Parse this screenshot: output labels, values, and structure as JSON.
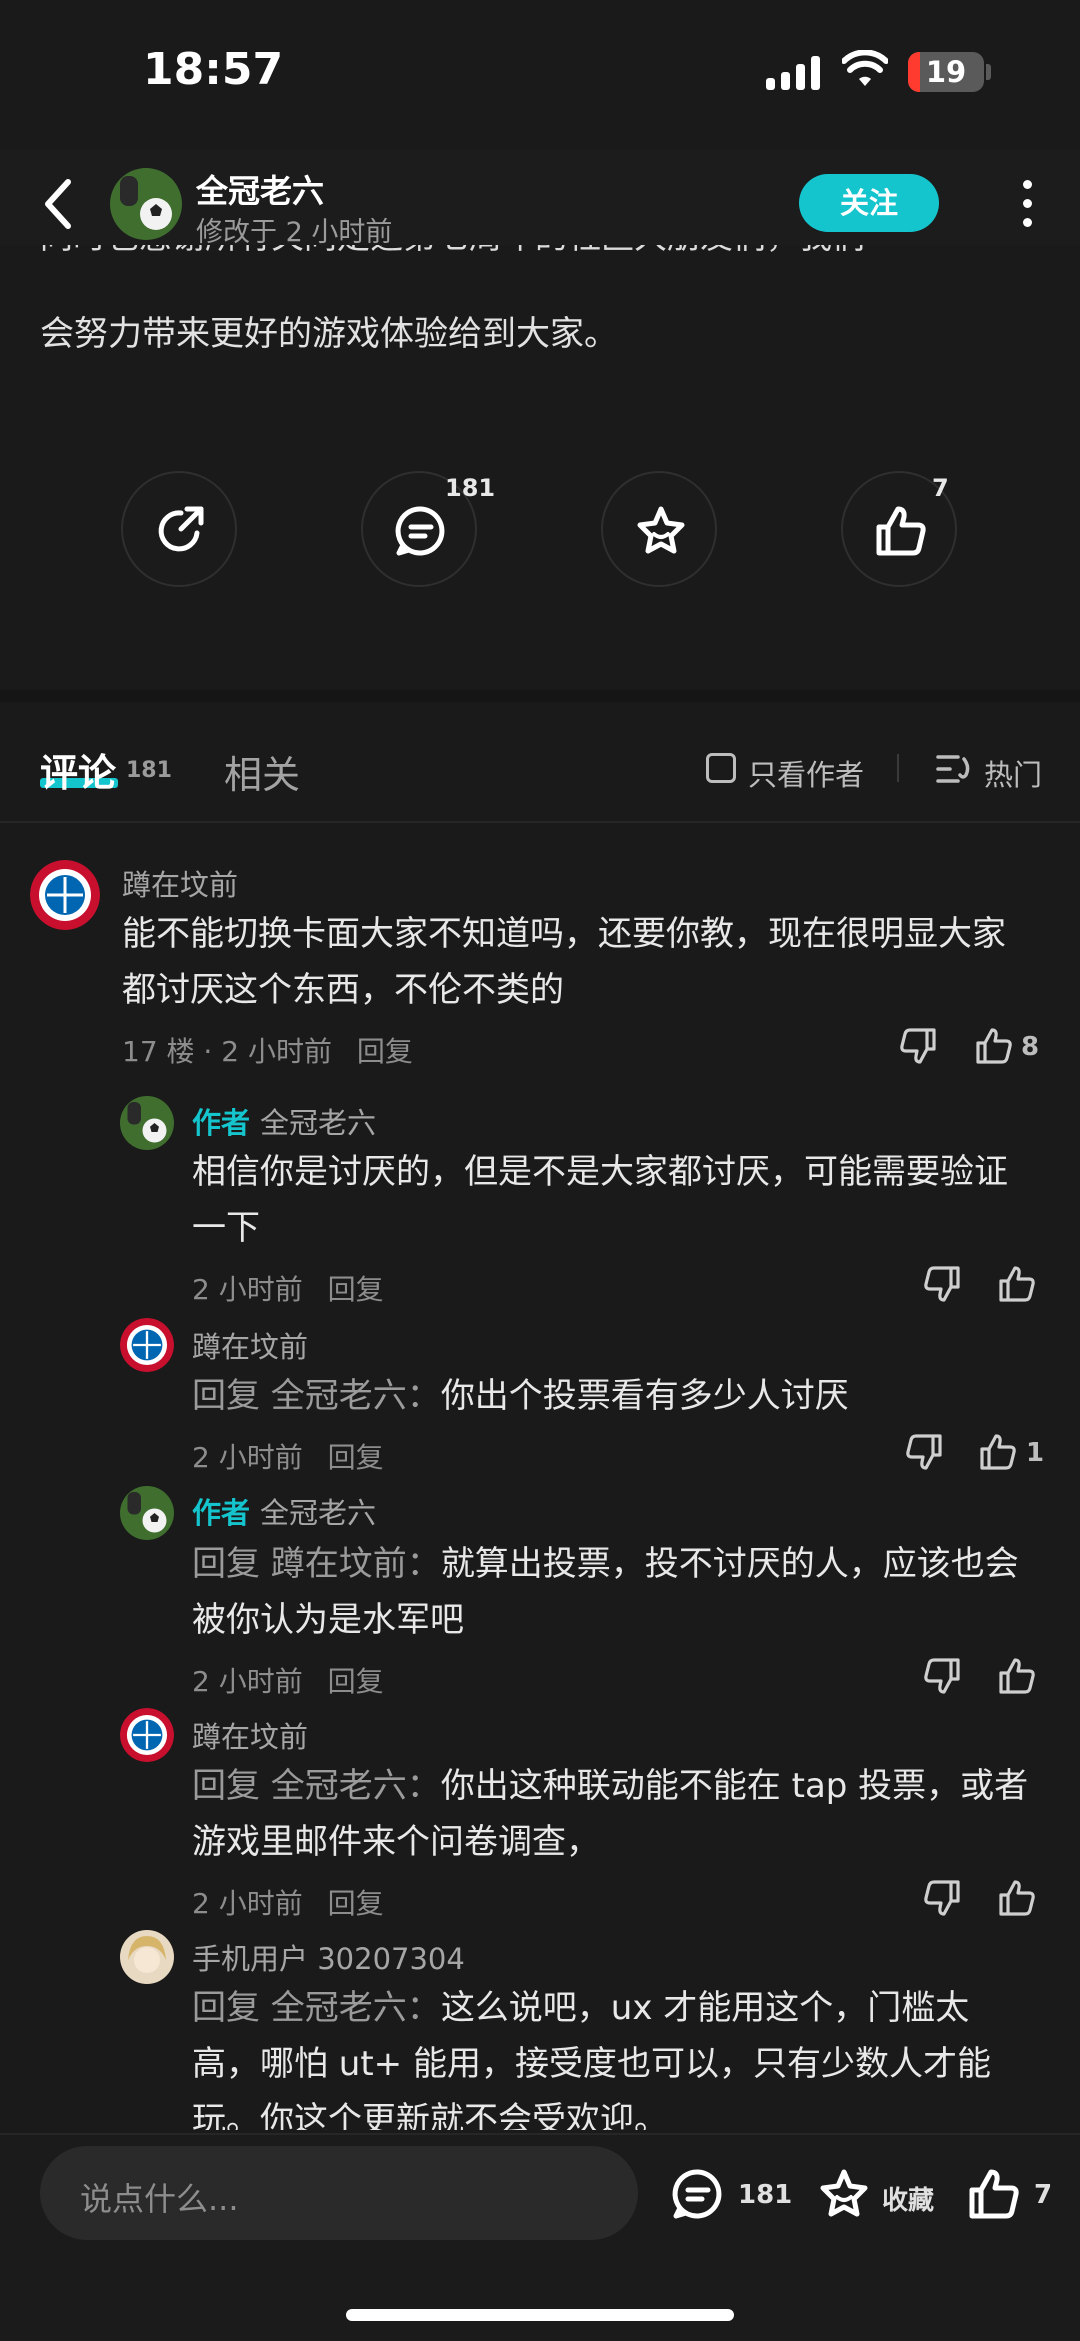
{
  "status_bar": {
    "time": "18:57",
    "battery": "19"
  },
  "header": {
    "author_name": "全冠老六",
    "modified": "修改于 2 小时前",
    "follow_label": "关注"
  },
  "article": {
    "cut_line": "同时也感谢所有关同定选第七周年的社区大朋友们，我们",
    "last_line": "会努力带来更好的游戏体验给到大家。"
  },
  "actions": {
    "comment_count": "181",
    "like_count": "7"
  },
  "tabs": {
    "comments_label": "评论",
    "comments_count": "181",
    "related_label": "相关",
    "only_author_label": "只看作者",
    "sort_label": "热门"
  },
  "comments": [
    {
      "name": "蹲在坟前",
      "text_line1": "能不能切换卡面大家不知道吗，还要你教，现在很明显大家",
      "text_line2": "都讨厌这个东西，不伦不类的",
      "meta": "17 楼 · 2 小时前",
      "reply_label": "回复",
      "likes": "8"
    }
  ],
  "replies": [
    {
      "author_tag": "作者",
      "name": "全冠老六",
      "text_line1": "相信你是讨厌的，但是不是大家都讨厌，可能需要验证",
      "text_line2": "一下",
      "meta": "2 小时前",
      "reply_label": "回复"
    },
    {
      "name": "蹲在坟前",
      "prefix": "回复 全冠老六：",
      "text_line1": "你出个投票看有多少人讨厌",
      "meta": "2 小时前",
      "reply_label": "回复",
      "likes": "1"
    },
    {
      "author_tag": "作者",
      "name": "全冠老六",
      "prefix": "回复 蹲在坟前：",
      "text_line1": "就算出投票，投不讨厌的人，应该也会",
      "text_line2": "被你认为是水军吧",
      "meta": "2 小时前",
      "reply_label": "回复"
    },
    {
      "name": "蹲在坟前",
      "prefix": "回复 全冠老六：",
      "text_line1": "你出这种联动能不能在 tap 投票，或者",
      "text_line2": "游戏里邮件来个问卷调查，",
      "meta": "2 小时前",
      "reply_label": "回复"
    },
    {
      "name": "手机用户 30207304",
      "prefix": "回复 全冠老六：",
      "text_line1": "这么说吧，ux 才能用这个，门槛太",
      "text_line2": "高，哪怕 ut+ 能用，接受度也可以，只有少数人才能",
      "text_line3": "玩。你这个更新就不会受欢迎。"
    }
  ],
  "bottom_bar": {
    "input_placeholder": "说点什么...",
    "comment_count": "181",
    "favorite_label": "收藏",
    "like_count": "7"
  },
  "colors": {
    "accent": "#15c5ce",
    "background": "#1a1a1a"
  },
  "icons": [
    "back-icon",
    "share-icon",
    "comment-icon",
    "star-icon",
    "thumbs-up-icon",
    "thumbs-down-icon",
    "sort-icon",
    "more-icon"
  ]
}
